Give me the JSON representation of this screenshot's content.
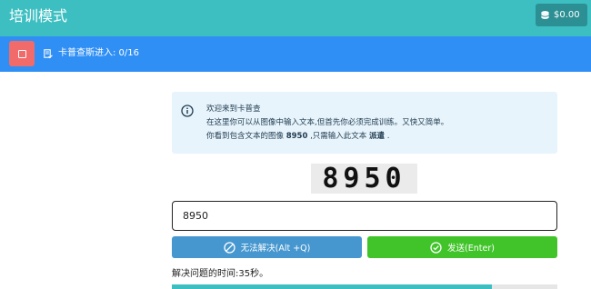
{
  "header": {
    "title": "培训模式",
    "balance": "$0.00",
    "coin_icon": "coins-icon",
    "accent_color": "#3dbfc2"
  },
  "infobar": {
    "stop_icon": "stop-icon",
    "progress_icon": "checklist-icon",
    "progress_text": "卡普查斯进入: 0/16",
    "color": "#2f8ff5"
  },
  "alert": {
    "icon": "info-icon",
    "line1": "欢迎来到卡普查",
    "line2": "在这里你可以从图像中输入文本,但首先你必须完成训练。又快又简单。",
    "line3_prefix": "你看到包含文本的图像",
    "line3_value": "8950",
    "line3_middle": ",只需输入此文本",
    "line3_action": "派遣",
    "line3_suffix": "."
  },
  "captcha": {
    "image_text": "8950",
    "answer_value": "8950"
  },
  "buttons": {
    "skip_label": "无法解决(Alt +Q)",
    "skip_icon": "prohibited-icon",
    "send_label": "发送(Enter)",
    "send_icon": "check-circle-icon"
  },
  "timer": {
    "text": "解决问题的时间:35秒。",
    "remaining_fraction": 0.83
  }
}
